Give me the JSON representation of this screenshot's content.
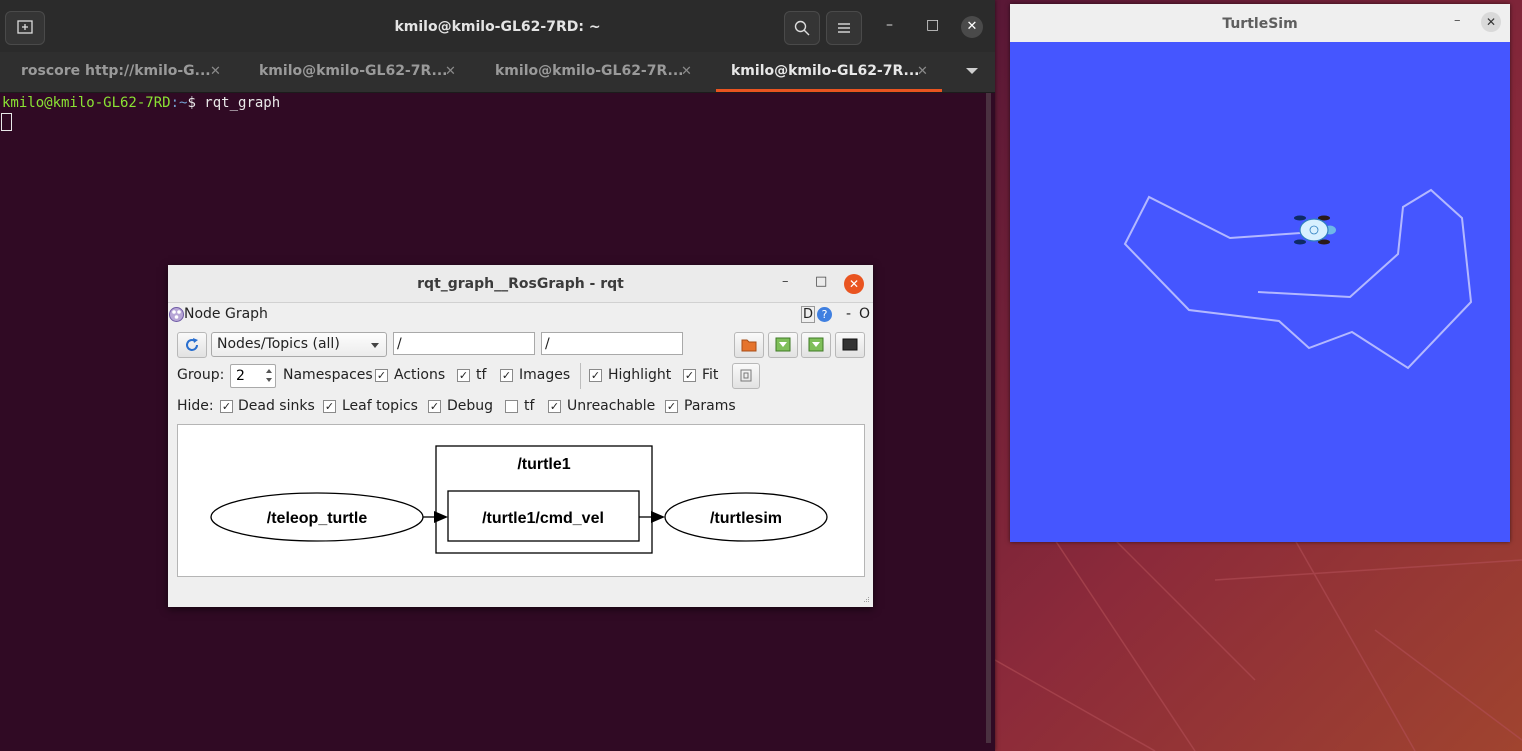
{
  "terminal": {
    "title": "kmilo@kmilo-GL62-7RD: ~",
    "tabs": [
      {
        "label": "roscore http://kmilo-G..."
      },
      {
        "label": "kmilo@kmilo-GL62-7R..."
      },
      {
        "label": "kmilo@kmilo-GL62-7R..."
      },
      {
        "label": "kmilo@kmilo-GL62-7R..."
      }
    ],
    "prompt_user": "kmilo@kmilo-GL62-7RD",
    "prompt_path": ":~",
    "prompt_symbol": "$ ",
    "command": "rqt_graph"
  },
  "turtlesim": {
    "title": "TurtleSim",
    "background_color": "#4556ff",
    "trail_color": "#b3b8ff"
  },
  "rqt": {
    "title": "rqt_graph__RosGraph - rqt",
    "plugin_title": "Node Graph",
    "dock_buttons": [
      "D",
      "?",
      "-",
      "O"
    ],
    "view_mode": "Nodes/Topics (all)",
    "node_filter": "/",
    "topic_filter": "/",
    "group_label": "Group:",
    "group_value": "2",
    "options": [
      {
        "label": "Namespaces",
        "checked": true
      },
      {
        "label": "Actions",
        "checked": true
      },
      {
        "label": "tf",
        "checked": true
      },
      {
        "label": "Images",
        "checked": true
      },
      {
        "label": "Highlight",
        "checked": true
      },
      {
        "label": "Fit",
        "checked": true
      }
    ],
    "hide_label": "Hide:",
    "hide_options": [
      {
        "label": "Dead sinks",
        "checked": true
      },
      {
        "label": "Leaf topics",
        "checked": true
      },
      {
        "label": "Debug",
        "checked": true
      },
      {
        "label": "tf",
        "checked": false
      },
      {
        "label": "Unreachable",
        "checked": true
      },
      {
        "label": "Params",
        "checked": true
      }
    ],
    "graph": {
      "namespace_box": "/turtle1",
      "nodes": [
        "/teleop_turtle",
        "/turtlesim"
      ],
      "topic": "/turtle1/cmd_vel"
    }
  },
  "colors": {
    "accent": "#e95420",
    "terminal_bg": "#300a24"
  }
}
